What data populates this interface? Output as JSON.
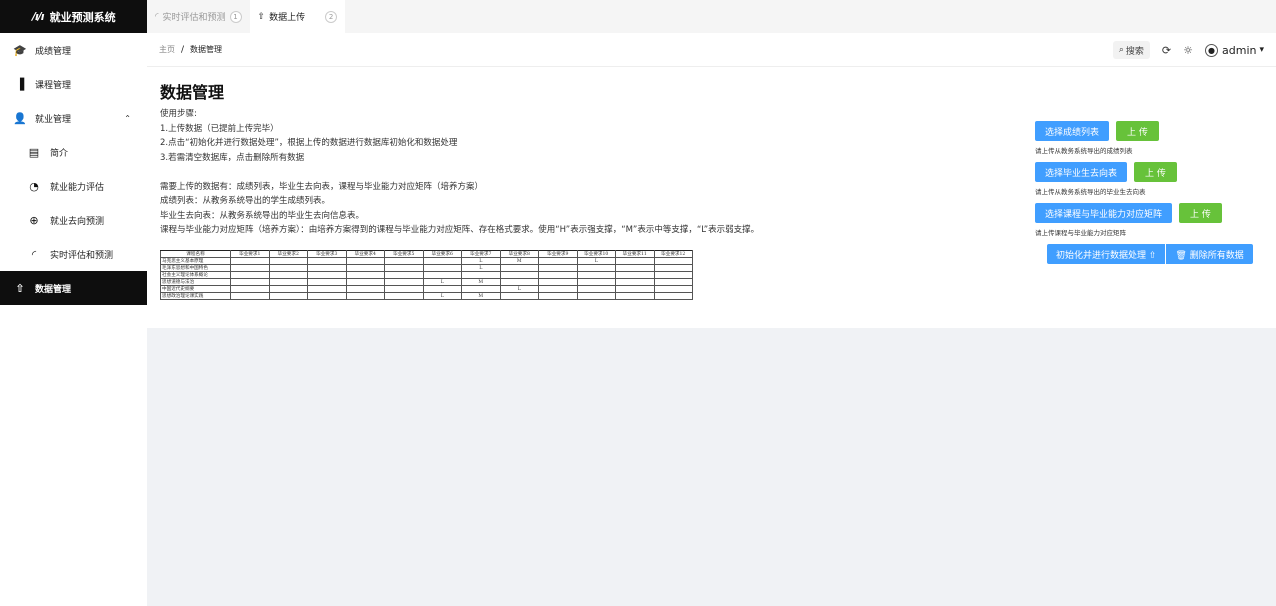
{
  "app": {
    "logo_mark": "/ı/ı",
    "title": "就业预测系统"
  },
  "sidebar": {
    "items": [
      {
        "label": "成绩管理",
        "icon": "graduation-cap-icon",
        "glyph": "🎓"
      },
      {
        "label": "课程管理",
        "icon": "book-icon",
        "glyph": "▐"
      },
      {
        "label": "就业管理",
        "icon": "user-icon",
        "glyph": "👤",
        "chevron": "⌃"
      },
      {
        "label": "简介",
        "icon": "document-icon",
        "glyph": "▤"
      },
      {
        "label": "就业能力评估",
        "icon": "gauge-icon",
        "glyph": "◔"
      },
      {
        "label": "就业去向预测",
        "icon": "compass-icon",
        "glyph": "⊕"
      },
      {
        "label": "实时评估和预测",
        "icon": "loading-icon",
        "glyph": "◜"
      },
      {
        "label": "数据管理",
        "icon": "upload-icon",
        "glyph": "⇧"
      }
    ]
  },
  "tabs": [
    {
      "label": "实时评估和预测",
      "num": "1",
      "glyph": "◜"
    },
    {
      "label": "数据上传",
      "num": "2",
      "glyph": "⇧"
    }
  ],
  "breadcrumb": {
    "home": "主页",
    "sep": "/",
    "current": "数据管理"
  },
  "header": {
    "search_label": "搜索",
    "user": "admin",
    "caret": "▾"
  },
  "page": {
    "title": "数据管理",
    "lines": [
      "使用步骤:",
      "1.上传数据（已提前上传完毕）",
      "2.点击“初始化并进行数据处理”，根据上传的数据进行数据库初始化和数据处理",
      "3.若需清空数据库，点击删除所有数据",
      "需要上传的数据有：成绩列表，毕业生去向表，课程与毕业能力对应矩阵（培养方案）",
      "成绩列表：从教务系统导出的学生成绩列表。",
      "毕业生去向表：从教务系统导出的毕业生去向信息表。",
      "课程与毕业能力对应矩阵（培养方案）：由培养方案得到的课程与毕业能力对应矩阵、存在格式要求。使用“H”表示强支撑，“M”表示中等支撑，“L”表示弱支撑。"
    ]
  },
  "matrix": {
    "headers": [
      "课程名称",
      "毕业要求1",
      "毕业要求2",
      "毕业要求3",
      "毕业要求4",
      "毕业要求5",
      "毕业要求6",
      "毕业要求7",
      "毕业要求8",
      "毕业要求9",
      "毕业要求10",
      "毕业要求11",
      "毕业要求12"
    ],
    "rows": [
      [
        "马克思主义基本原理",
        "",
        "",
        "",
        "",
        "",
        "",
        "L",
        "M",
        "",
        "L",
        "",
        ""
      ],
      [
        "毛泽东思想和中国特色",
        "",
        "",
        "",
        "",
        "",
        "",
        "L",
        "",
        "",
        "",
        "",
        ""
      ],
      [
        "社会主义理论体系概论",
        "",
        "",
        "",
        "",
        "",
        "",
        "",
        "",
        "",
        "",
        "",
        ""
      ],
      [
        "思想道德与法治",
        "",
        "",
        "",
        "",
        "",
        "L",
        "M",
        "",
        "",
        "",
        "",
        ""
      ],
      [
        "中国近代史纲要",
        "",
        "",
        "",
        "",
        "",
        "",
        "",
        "L",
        "",
        "",
        "",
        ""
      ],
      [
        "思想政治理论课实践",
        "",
        "",
        "",
        "",
        "",
        "L",
        "M",
        "",
        "",
        "",
        "",
        ""
      ]
    ]
  },
  "panel": {
    "uploads": [
      {
        "select_label": "选择成绩列表",
        "upload_label": "上 传",
        "hint": "请上传从教务系统导出的成绩列表"
      },
      {
        "select_label": "选择毕业生去向表",
        "upload_label": "上 传",
        "hint": "请上传从教务系统导出的毕业生去向表"
      },
      {
        "select_label": "选择课程与毕业能力对应矩阵",
        "upload_label": "上 传",
        "hint": "请上传课程与毕业能力对应矩阵"
      }
    ],
    "init_label": "初始化并进行数据处理 ⇧",
    "delete_label": "🗑 删除所有数据"
  },
  "colors": {
    "primary": "#409eff",
    "success": "#67c23a",
    "sidebar_active": "#0e0e0e"
  }
}
